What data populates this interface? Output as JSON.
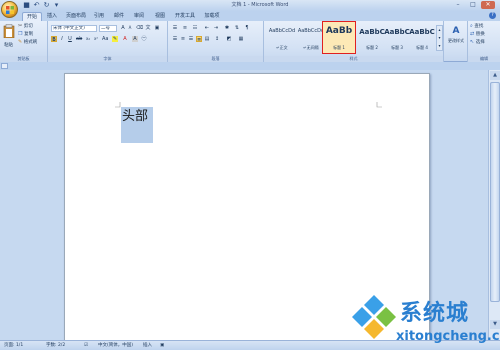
{
  "titlebar": {
    "title": "文档 1 - Microsoft Word",
    "minimize": "–",
    "maximize": "□",
    "close": "✕"
  },
  "tabs": [
    "开始",
    "插入",
    "页面布局",
    "引用",
    "邮件",
    "审阅",
    "视图",
    "开发工具",
    "加载项"
  ],
  "ribbon": {
    "clipboard": {
      "paste": "粘贴",
      "cut": "剪切",
      "copy": "复制",
      "format_painter": "格式刷",
      "label": "剪贴板"
    },
    "font": {
      "font_name": "宋体 (中文正文)",
      "font_size": "二号",
      "label": "字体"
    },
    "paragraph": {
      "label": "段落"
    },
    "styles": {
      "label": "样式",
      "items": [
        {
          "sample": "AaBbCcDd",
          "name": "↵正文"
        },
        {
          "sample": "AaBbCcDd",
          "name": "↵无间隔"
        },
        {
          "sample": "AaBb",
          "name": "标题 1"
        },
        {
          "sample": "AaBbC",
          "name": "标题 2"
        },
        {
          "sample": "AaBbC",
          "name": "标题 3"
        },
        {
          "sample": "AaBbC",
          "name": "标题 4"
        }
      ],
      "change_styles": "更改样式"
    },
    "editing": {
      "find": "查找",
      "replace": "替换",
      "select": "选择",
      "label": "编辑"
    }
  },
  "document": {
    "selected_text": "头部"
  },
  "statusbar": {
    "page": "页面: 1/1",
    "words": "字数: 2/2",
    "language": "中文(简体，中国)",
    "insert_mode": "插入"
  },
  "watermark": {
    "name": "系统城",
    "url": "xitongcheng.com"
  },
  "colors": {
    "accent": "#2a7fd0",
    "selection": "#b5cdea",
    "highlight_border": "#e02020"
  }
}
